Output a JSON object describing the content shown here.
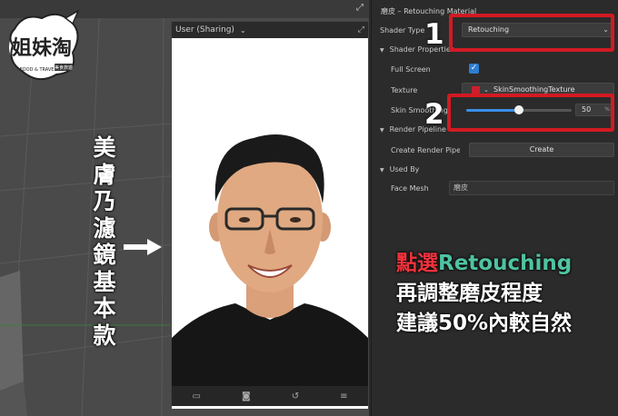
{
  "viewport": {
    "logo": {
      "brand": "姐妹淘",
      "tagline": "FOOD & TRAVEL",
      "subtag": "美食旅遊"
    },
    "vertical_caption": [
      "美",
      "膚",
      "乃",
      "濾",
      "鏡",
      "基",
      "本",
      "款"
    ],
    "arrow_icon": "right-arrow-icon"
  },
  "simulator": {
    "user_label": "User (Sharing)",
    "toolbar_icons": [
      "video-icon",
      "screenshot-icon",
      "rotate-icon",
      "menu-icon"
    ]
  },
  "inspector": {
    "title": "磨皮 – Retouching Material",
    "shader_type": {
      "label": "Shader Type",
      "value": "Retouching"
    },
    "shader_properties": {
      "label": "Shader Properties"
    },
    "full_screen": {
      "label": "Full Screen",
      "checked": true
    },
    "texture": {
      "label": "Texture",
      "value": "SkinSmoothingTexture",
      "swatch_color": "#cc1f2e"
    },
    "skin_smoothing": {
      "label": "Skin Smoothing",
      "value": "50",
      "unit": "%",
      "fraction": 0.5
    },
    "render_pipeline": {
      "label": "Render Pipeline",
      "create_label": "Create Render Pipeli...",
      "button_label": "Create"
    },
    "used_by": {
      "label": "Used By",
      "face_mesh_label": "Face Mesh",
      "face_mesh_value": "磨皮"
    }
  },
  "annotations": {
    "marker_1": "1",
    "marker_2": "2",
    "callout_color": "#d21a23",
    "caption": {
      "line1_red": "點選",
      "line1_green": "Retouching",
      "line2": "再調整磨皮程度",
      "line3": "建議50%內較自然"
    }
  },
  "colors": {
    "accent_blue": "#2d7dd2",
    "caption_red": "#f0323c",
    "caption_green": "#4fc3a1"
  }
}
